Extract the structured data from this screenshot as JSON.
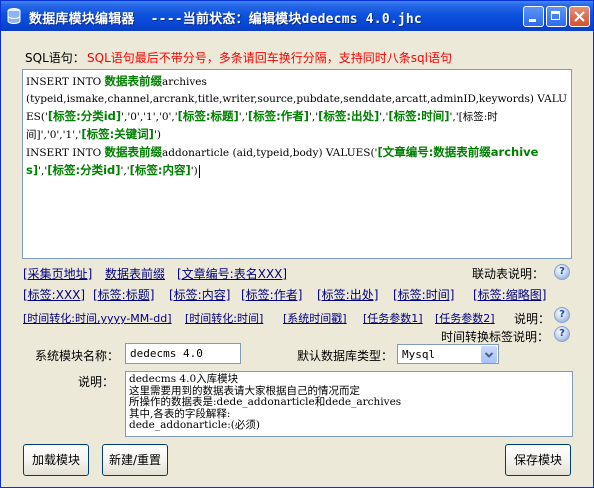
{
  "window": {
    "title": "数据库模块编辑器  ----当前状态：编辑模块dedecms 4.0.jhc"
  },
  "sql": {
    "label": "SQL语句：",
    "hint": "SQL语句最后不带分号，多条请回车换行分隔，支持同时八条sql语句",
    "editor_line1_prefix": "INSERT INTO ",
    "editor_line1_tag": "数据表前缀",
    "editor_line1_suffix": "archives",
    "editor_line2a": "(typeid,ismake,channel,arcrank,title,writer,source,pubdate,senddate,arcatt,adminID,keywords) VALUES('",
    "editor_tag_category": "[标签:分类id]",
    "editor_mid1": "','0','1','0','",
    "editor_tag_title": "[标签:标题]",
    "editor_mid2": "','",
    "editor_tag_author": "[标签:作者]",
    "editor_mid3": "','",
    "editor_tag_source": "[标签:出处]",
    "editor_mid4": "','",
    "editor_tag_time": "[标签:时间]",
    "editor_mid5": "','",
    "editor_time_plain": "[标签:时间]",
    "editor_mid6": "','0','1','",
    "editor_tag_keywords": "[标签:关键词]",
    "editor_end1": "')",
    "editor_line3_prefix": "INSERT INTO ",
    "editor_line3_tag": "数据表前缀",
    "editor_line3_suffix": "addonarticle (aid,typeid,body) VALUES('",
    "editor_tag_article_id": "[文章编号:数据表前缀archives]",
    "editor_mid7": "','",
    "editor_tag_category2": "[标签:分类id]",
    "editor_mid8": "','",
    "editor_tag_content": "[标签:内容]",
    "editor_end2": "')"
  },
  "links_row1": [
    "[采集页地址]",
    "数据表前缀",
    "[文章编号:表名XXX]"
  ],
  "linkage_label": "联动表说明：",
  "links_row2": [
    "[标签:XXX]",
    "[标签:标题]",
    "[标签:内容]",
    "[标签:作者]",
    "[标签:出处]",
    "[标签:时间]",
    "[标签:缩略图]"
  ],
  "links_row3": [
    "[时间转化:时间,yyyy-MM-dd]",
    "[时间转化:时间]",
    "[系统时间戳]",
    "[任务参数1]",
    "[任务参数2]"
  ],
  "explain_label": "说明：",
  "time_tag_label": "时间转换标签说明：",
  "help_glyph": "?",
  "module_name": {
    "label": "系统模块名称：",
    "value": "dedecms 4.0"
  },
  "db_type": {
    "label": "默认数据库类型：",
    "value": "Mysql"
  },
  "description": {
    "label": "说明：",
    "lines": [
      "dedecms 4.0入库模块",
      "这里需要用到的数据表请大家根据自己的情况而定",
      "所操作的数据表是:dede_addonarticle和dede_archives",
      "其中,各表的字段解释:",
      "dede_addonarticle:(必须)"
    ]
  },
  "buttons": {
    "load": "加载模块",
    "new_reset": "新建/重置",
    "save": "保存模块"
  },
  "colors": {
    "titlebar": "#0848D8",
    "hint_red": "#FF0000",
    "tag_green": "#008000",
    "link_blue": "#000080"
  }
}
